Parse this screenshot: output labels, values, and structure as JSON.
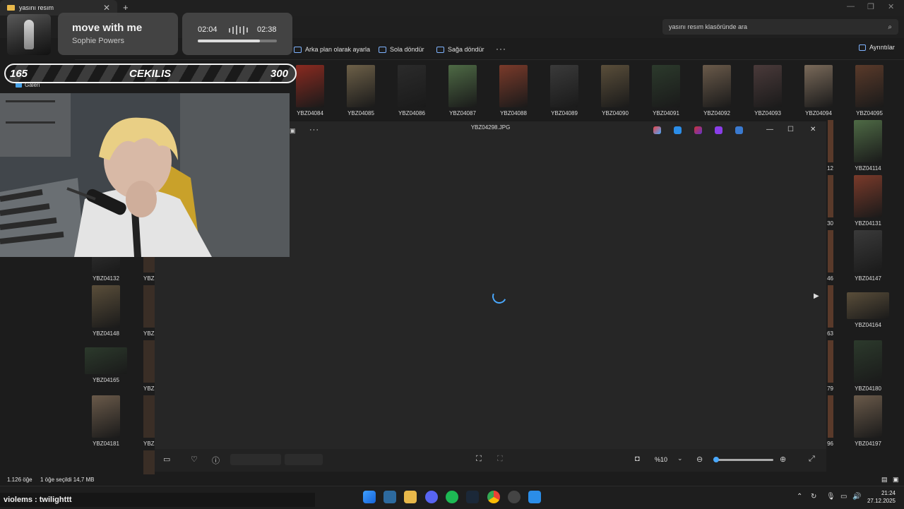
{
  "explorer": {
    "tab_title": "yasını resım",
    "search_placeholder": "yasını resım klasöründe ara",
    "commands": [
      "Arka plan olarak ayarla",
      "Sola döndür",
      "Sağa döndür"
    ],
    "more": "···",
    "details": "Ayrıntılar",
    "nav_item": "Galeri"
  },
  "thumbnails": {
    "row1": [
      "YBZ04084",
      "YBZ04085",
      "YBZ04086",
      "YBZ04087",
      "YBZ04088",
      "YBZ04089",
      "YBZ04090",
      "YBZ04091",
      "YBZ04092",
      "YBZ04093",
      "YBZ04094",
      "YBZ04095"
    ],
    "right_col": [
      "YBZ04114",
      "YBZ04131",
      "YBZ04147",
      "YBZ04164",
      "YBZ04180",
      "YBZ04197"
    ],
    "right_partial": [
      "12",
      "30",
      "46",
      "63",
      "79",
      "96"
    ],
    "left_col": [
      "YBZ04132",
      "YBZ04148",
      "YBZ04165",
      "YBZ04181"
    ],
    "left_partial": [
      "YBZ",
      "YBZ",
      "YBZ",
      "YBZ",
      "YBZ"
    ]
  },
  "viewer": {
    "title": "YBZ04298.JPG",
    "zoom": "%10"
  },
  "status": {
    "count": "1.126 öğe",
    "selected": "1 öğe seçildi  14,7 MB"
  },
  "clock": {
    "time": "21:24",
    "date": "27.12.2025"
  },
  "overlay": {
    "song_title": "move with me",
    "artist": "Sophie Powers",
    "time_now": "02:04",
    "time_total": "02:38",
    "progress": 0.79,
    "raffle_left": "165",
    "raffle_label": "CEKILIS",
    "raffle_right": "300",
    "chat_line": "violems : twilighttt"
  },
  "colors": {
    "accent": "#4aa9ff",
    "folder": "#e8b84a"
  }
}
